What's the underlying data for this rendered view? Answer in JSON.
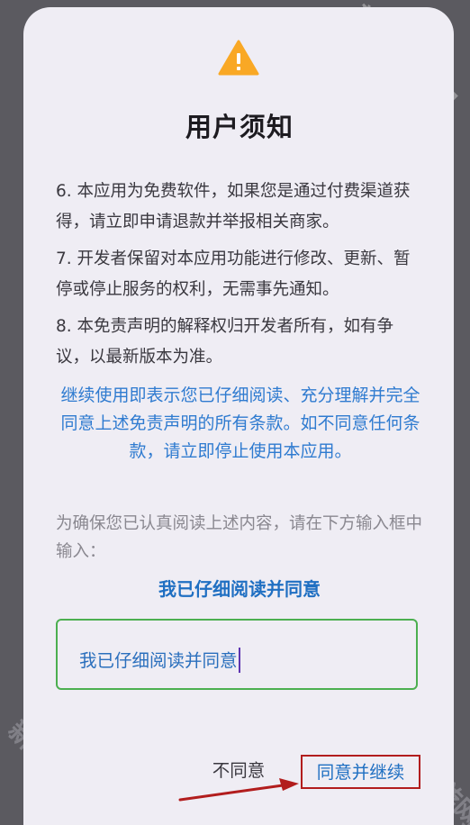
{
  "dialog": {
    "title": "用户须知",
    "terms": [
      "6. 本应用为免费软件，如果您是通过付费渠道获得，请立即申请退款并举报相关商家。",
      "7. 开发者保留对本应用功能进行修改、更新、暂停或停止服务的权利，无需事先通知。",
      "8. 本免责声明的解释权归开发者所有，如有争议，以最新版本为准。"
    ],
    "agree_notice": "继续使用即表示您已仔细阅读、充分理解并完全同意上述免责声明的所有条款。如不同意任何条款，请立即停止使用本应用。",
    "input_hint": "为确保您已认真阅读上述内容，请在下方输入框中输入：",
    "confirm_phrase": "我已仔细阅读并同意",
    "input_value": "我已仔细阅读并同意",
    "disagree_label": "不同意",
    "agree_label": "同意并继续"
  },
  "watermark": {
    "text": "新华手游网"
  },
  "colors": {
    "backdrop": "#5b5a60",
    "dialog_bg": "#efedf4",
    "warning": "#f9a825",
    "link_blue": "#1f6fc2",
    "input_border": "#4caf50",
    "annotation_red": "#b21d1d"
  },
  "icons": {
    "warning": "warning-triangle-icon"
  }
}
